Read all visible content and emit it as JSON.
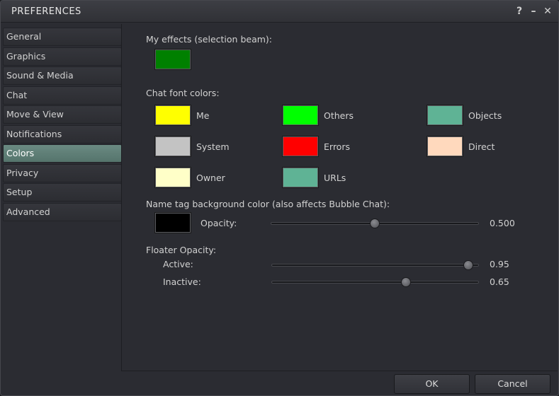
{
  "window": {
    "title": "PREFERENCES",
    "help": "?",
    "minimize": "–",
    "close": "✕"
  },
  "tabs": [
    {
      "label": "General"
    },
    {
      "label": "Graphics"
    },
    {
      "label": "Sound & Media"
    },
    {
      "label": "Chat"
    },
    {
      "label": "Move & View"
    },
    {
      "label": "Notifications"
    },
    {
      "label": "Colors",
      "active": true
    },
    {
      "label": "Privacy"
    },
    {
      "label": "Setup"
    },
    {
      "label": "Advanced"
    }
  ],
  "colors": {
    "effects_label": "My effects (selection beam):",
    "effects_color": "#008000",
    "chat_label": "Chat font colors:",
    "chat": [
      {
        "label": "Me",
        "color": "#ffff00"
      },
      {
        "label": "Others",
        "color": "#00ff00"
      },
      {
        "label": "Objects",
        "color": "#5fb395"
      },
      {
        "label": "System",
        "color": "#c3c3c3"
      },
      {
        "label": "Errors",
        "color": "#ff0000"
      },
      {
        "label": "Direct",
        "color": "#ffd9bd"
      },
      {
        "label": "Owner",
        "color": "#ffffc8"
      },
      {
        "label": "URLs",
        "color": "#5fb395"
      }
    ],
    "nametag_label": "Name tag background color (also affects Bubble Chat):",
    "nametag_color": "#000000",
    "opacity_label": "Opacity:",
    "opacity_value": "0.500",
    "opacity_fraction": 0.5,
    "floater_label": "Floater Opacity:",
    "active_label": "Active:",
    "active_value": "0.95",
    "active_fraction": 0.95,
    "inactive_label": "Inactive:",
    "inactive_value": "0.65",
    "inactive_fraction": 0.65
  },
  "footer": {
    "ok": "OK",
    "cancel": "Cancel"
  }
}
